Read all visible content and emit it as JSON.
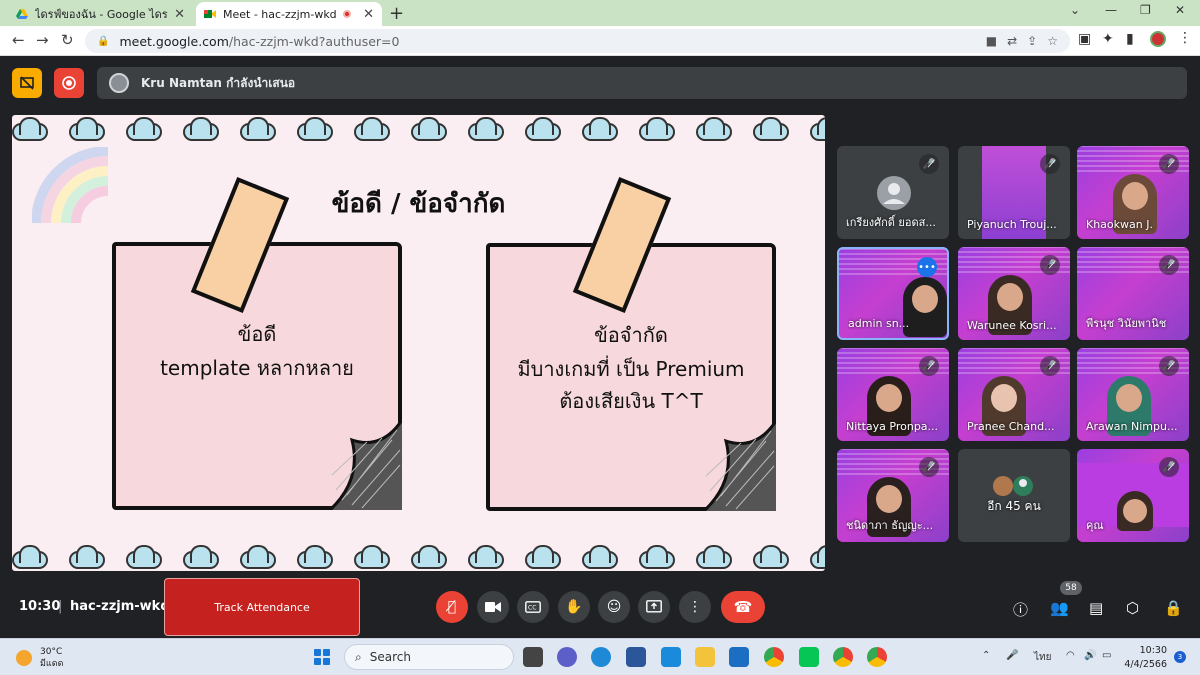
{
  "browser": {
    "tabs": [
      {
        "title": "ไดรฟ์ของฉัน - Google ไดรฟ์",
        "icon": "google-drive-icon"
      },
      {
        "title": "Meet - hac-zzjm-wkd",
        "icon": "google-meet-icon",
        "recording": true
      }
    ],
    "url_host": "meet.google.com",
    "url_path": "/hac-zzjm-wkd?authuser=0"
  },
  "meet": {
    "presenter_label": "Kru Namtan กำลังนำเสนอ",
    "slide": {
      "title": "ข้อดี / ข้อจำกัด",
      "left_heading": "ข้อดี",
      "left_body": "template หลากหลาย",
      "right_heading": "ข้อจำกัด",
      "right_line1": "มีบางเกมที่ เป็น Premium",
      "right_line2": "ต้องเสียเงิน T^T"
    },
    "participants": [
      {
        "name": "เกรียงศักดิ์ ยอดส...",
        "muted": true,
        "style": "avatar"
      },
      {
        "name": "Piyanuch Trouj...",
        "muted": true,
        "style": "slide"
      },
      {
        "name": "Khaokwan J.",
        "muted": true,
        "style": "purple"
      },
      {
        "name": "admin sn...",
        "muted": false,
        "speaking": true,
        "style": "purple"
      },
      {
        "name": "Warunee Kosri...",
        "muted": true,
        "style": "purple"
      },
      {
        "name": "พีรนุช วินัยพานิช",
        "muted": true,
        "style": "purple"
      },
      {
        "name": "Nittaya Pronpa...",
        "muted": true,
        "style": "purple"
      },
      {
        "name": "Pranee Chand...",
        "muted": true,
        "style": "purple"
      },
      {
        "name": "Arawan Nimpu...",
        "muted": true,
        "style": "purple"
      },
      {
        "name": "ชนิดาภา ธัญญะ...",
        "muted": true,
        "style": "purple"
      },
      {
        "name": "อีก 45 คน",
        "style": "more"
      },
      {
        "name": "คุณ",
        "muted": true,
        "style": "purple"
      }
    ],
    "bottom": {
      "time": "10:30",
      "separator": "|",
      "meeting_code": "hac-zzjm-wkd",
      "track_attendance": "Track Attendance",
      "people_count": "58"
    }
  },
  "taskbar": {
    "temperature": "30°C",
    "weather": "มีแดด",
    "search": "Search",
    "language": "ไทย",
    "clock_time": "10:30",
    "clock_date": "4/4/2566",
    "notification_count": "3"
  }
}
